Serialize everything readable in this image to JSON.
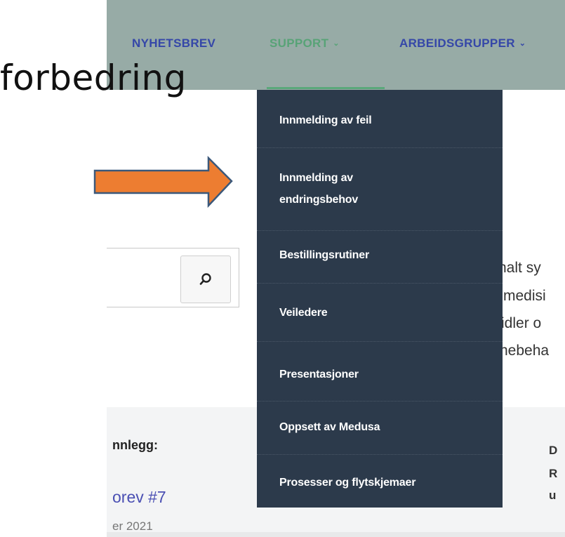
{
  "slide": {
    "title": "forbedring",
    "arrow_color": "#ed7d31"
  },
  "nav": {
    "items": [
      {
        "label": "NYHETSBREV"
      },
      {
        "label": "SUPPORT",
        "active": true
      },
      {
        "label": "ARBEIDSGRUPPER"
      }
    ],
    "bar_color": "#97aba6",
    "link_color": "#3547a8",
    "active_color": "#58a377"
  },
  "dropdown": {
    "background": "#2c3a4b",
    "items": [
      {
        "label": "Innmelding av feil"
      },
      {
        "line1": "Innmelding av",
        "line2": "endringsbehov"
      },
      {
        "label": "Bestillingsrutiner"
      },
      {
        "label": "Veiledere"
      },
      {
        "label": "Presentasjoner"
      },
      {
        "label": "Oppsett av Medusa"
      },
      {
        "label": "Prosesser og flytskjemaer"
      }
    ]
  },
  "search": {
    "icon": "search-icon"
  },
  "background_text": {
    "fragments": [
      "nalt sy",
      "medis",
      "i",
      "idler o",
      "nebeha"
    ],
    "sidebar_label": "nnlegg:",
    "sidebar_link": "orev #7",
    "sidebar_date": "er 2021",
    "right_letters": [
      "D",
      "R",
      "u"
    ]
  }
}
